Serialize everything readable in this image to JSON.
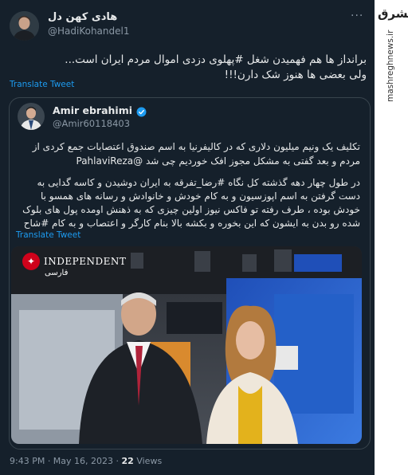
{
  "tweet": {
    "author_name": "هادی کهن دل",
    "author_handle": "@HadiKohandel1",
    "text_line1": "برانداز ها هم فهمیدن شغل #پهلوی دزدی اموال مردم ایران است...",
    "text_line2": "ولی بعضی ها هنوز شک دارن!!!",
    "translate_label": "Translate Tweet",
    "timestamp": "9:43 PM · May 16, 2023 ·",
    "views_count": "22",
    "views_label": "Views"
  },
  "quoted": {
    "author_name": "Amir ebrahimi",
    "author_handle": "@Amir60118403",
    "para1_line1": "تکلیف یک ونیم میلیون دلاری که در کالیفرنیا به اسم صندوق اعتصابات جمع کردی از",
    "para1_line2": "مردم و بعد گفتی به مشکل مجوز افک خوردیم چی شد @PahlaviReza",
    "para2_line1": "در طول چهار دهه گذشته کل نگاه #رضا_تفرقه به ایران دوشیدن و کاسه گدایی به",
    "para2_line2": "دست گرفتن به اسم اپوزسیون و به کام خودش و خانوادش و رسانه های همسو با",
    "para2_line3": "خودش بوده ، طرف رفته تو فاکس نیوز اولین چیزی که به ذهنش اومده پول های بلوک",
    "para2_line4": "شده رو بدن به ایشون که این بخوره و بکشه بالا بنام کارگر و اعتصاب و به کام #شاح",
    "translate_label": "Translate Tweet",
    "image_logo": "INDEPENDENT",
    "image_logo_sub": "فارسی"
  },
  "sidebar": {
    "brand": "مشرق",
    "url": "mashreghnews.ir"
  },
  "icons": {
    "verified": "verified-badge-icon",
    "more": "more-options-icon"
  },
  "colors": {
    "background": "#15202b",
    "text": "#e7e9ea",
    "muted": "#8b98a5",
    "link": "#1d9bf0",
    "border": "#38444d"
  }
}
